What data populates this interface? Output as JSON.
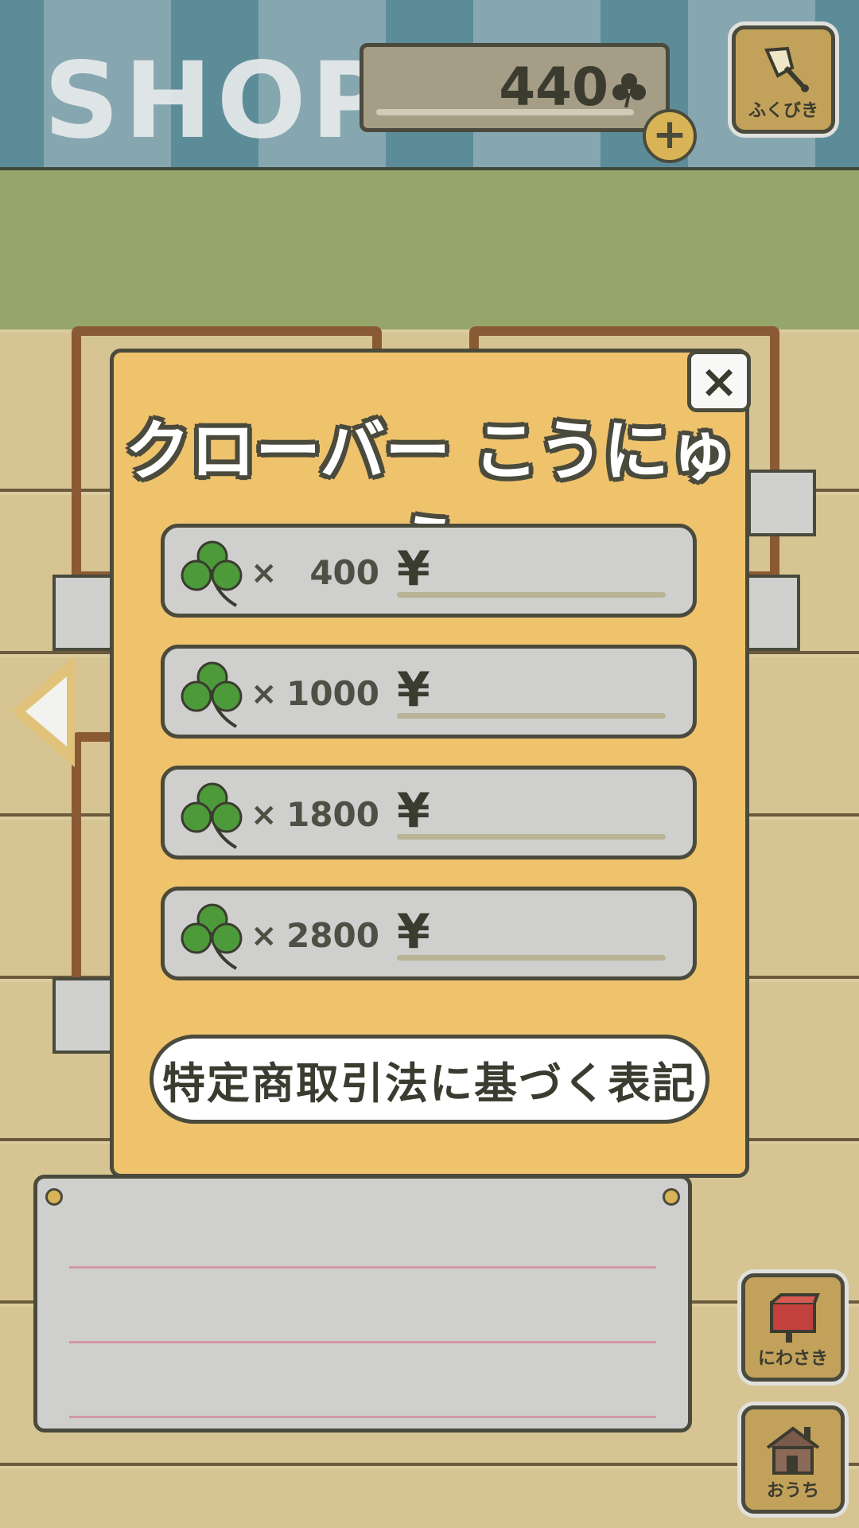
{
  "header": {
    "title": "SHOP",
    "clover_count": "440",
    "add_button_symbol": "+",
    "lottery_label": "ふくびき"
  },
  "modal": {
    "title": "クローバー こうにゅう",
    "close_symbol": "×",
    "options": [
      {
        "times": "×",
        "amount": "400",
        "currency": "¥"
      },
      {
        "times": "×",
        "amount": "1000",
        "currency": "¥"
      },
      {
        "times": "×",
        "amount": "1800",
        "currency": "¥"
      },
      {
        "times": "×",
        "amount": "2800",
        "currency": "¥"
      }
    ],
    "legal_notice_label": "特定商取引法に基づく表記"
  },
  "side_buttons": {
    "garden_label": "にわさき",
    "home_label": "おうち"
  },
  "colors": {
    "modal_background": "#efc36c",
    "clover_green": "#4d9a3a",
    "outline": "#4a4a3d",
    "header_stripe_dark": "#5d8c99",
    "header_stripe_light": "#86a7b0"
  },
  "icons": {
    "clover": "clover-icon",
    "lottery": "lottery-bell-icon",
    "garden": "garden-mailbox-icon",
    "home": "house-icon",
    "close": "close-icon",
    "back": "left-arrow-icon"
  }
}
